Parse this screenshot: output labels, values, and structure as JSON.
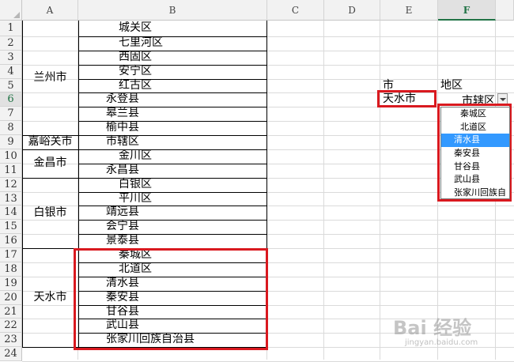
{
  "columns": [
    "A",
    "B",
    "C",
    "D",
    "E",
    "F"
  ],
  "rows": [
    "1",
    "2",
    "3",
    "4",
    "5",
    "6",
    "7",
    "8",
    "9",
    "10",
    "11",
    "12",
    "13",
    "14",
    "15",
    "16",
    "17",
    "18",
    "19",
    "20",
    "21",
    "22",
    "23",
    "24"
  ],
  "cities": [
    "兰州市",
    "嘉峪关市",
    "金昌市",
    "白银市",
    "天水市"
  ],
  "districts": [
    "城关区",
    "七里河区",
    "西固区",
    "安宁区",
    "红古区",
    "永登县",
    "皋兰县",
    "榆中县",
    "市辖区",
    "金川区",
    "永昌县",
    "白银区",
    "平川区",
    "靖远县",
    "会宁县",
    "景泰县",
    "秦城区",
    "北道区",
    "清水县",
    "秦安县",
    "甘谷县",
    "武山县",
    "张家川回族自治县"
  ],
  "lookup": {
    "e5": "市",
    "f5": "地区",
    "e6": "天水市",
    "f6": "市辖区"
  },
  "dropdown_options": [
    "秦城区",
    "北道区",
    "清水县",
    "秦安县",
    "甘谷县",
    "武山县",
    "张家川回族自"
  ],
  "watermark": "Bai 经验",
  "watermark_sub": "jingyan.baidu.com",
  "colors": {
    "highlight_border": "#d9191f",
    "selected_option": "#3399ff",
    "active_header": "#1f7244"
  }
}
